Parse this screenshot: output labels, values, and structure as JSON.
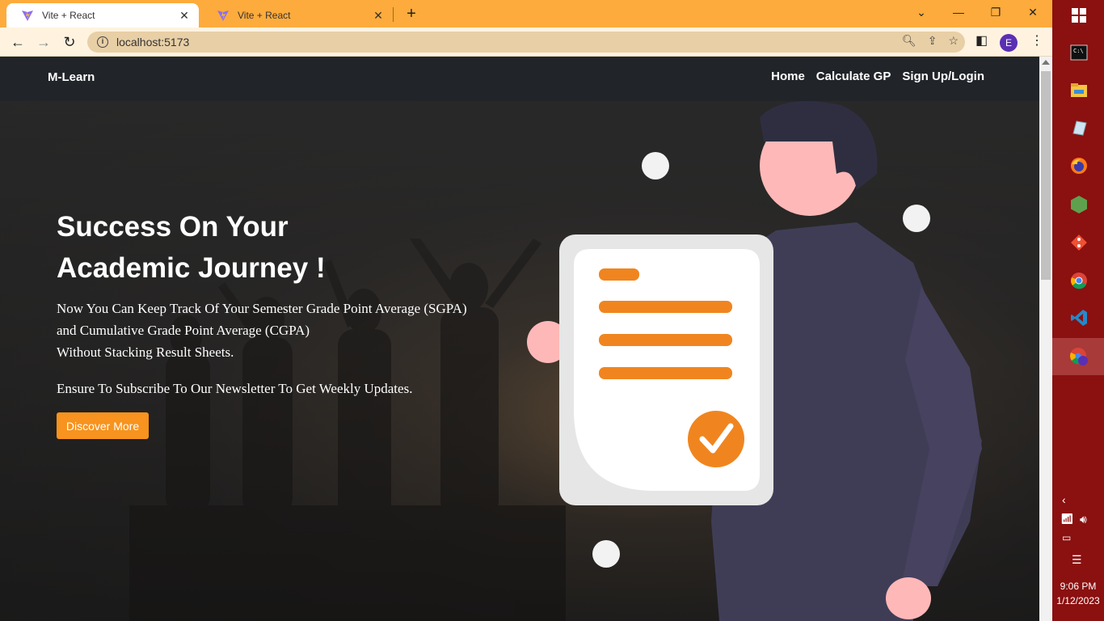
{
  "browser": {
    "tabs": [
      {
        "title": "Vite + React",
        "active": true
      },
      {
        "title": "Vite + React",
        "active": false
      }
    ],
    "url": "localhost:5173",
    "profile_initial": "E",
    "accent_color": "#fdab3c"
  },
  "navbar": {
    "brand": "M-Learn",
    "links": [
      "Home",
      "Calculate GP",
      "Sign Up/Login"
    ]
  },
  "hero": {
    "heading_line1": "Success On Your",
    "heading_line2": "Academic Journey !",
    "paragraph_line1": "Now You Can Keep Track Of Your Semester Grade Point Average (SGPA)",
    "paragraph_line2": "and Cumulative Grade Point Average (CGPA)",
    "paragraph_line3": "Without Stacking Result Sheets.",
    "subscribe_text": "Ensure To Subscribe To Our Newsletter To Get Weekly Updates.",
    "cta_label": "Discover More",
    "cta_color": "#f7931e"
  },
  "taskbar": {
    "icons": [
      "windows-start-icon",
      "cmd-icon",
      "file-explorer-icon",
      "notepad-icon",
      "firefox-icon",
      "nodejs-icon",
      "git-icon",
      "chrome-icon",
      "vscode-icon",
      "chrome-profile-icon"
    ],
    "time": "9:06 PM",
    "date": "1/12/2023",
    "color": "#8b1010"
  }
}
